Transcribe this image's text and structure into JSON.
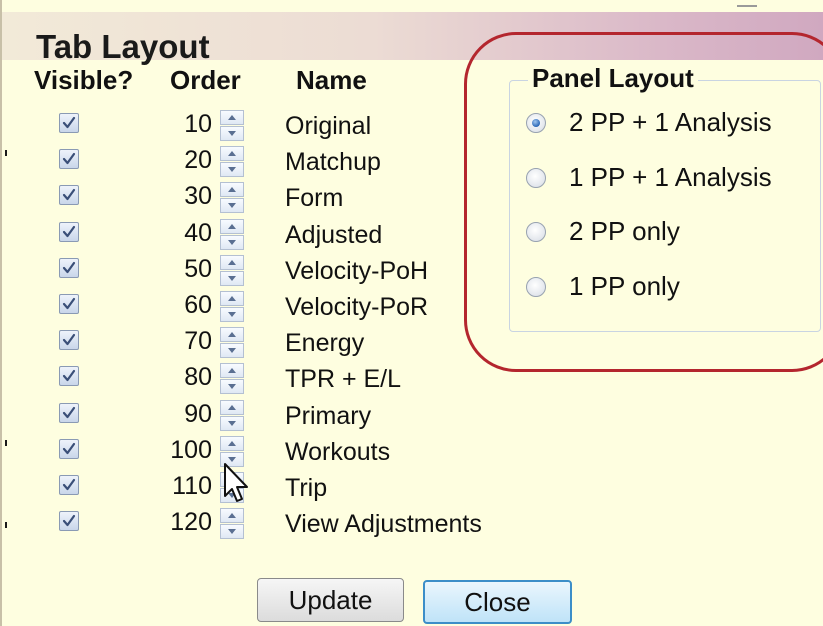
{
  "dialog": {
    "title": "Tab Layout",
    "columns": {
      "visible": "Visible?",
      "order": "Order",
      "name": "Name"
    },
    "tabs": [
      {
        "visible": true,
        "order": "10",
        "name": "Original"
      },
      {
        "visible": true,
        "order": "20",
        "name": "Matchup"
      },
      {
        "visible": true,
        "order": "30",
        "name": "Form"
      },
      {
        "visible": true,
        "order": "40",
        "name": "Adjusted"
      },
      {
        "visible": true,
        "order": "50",
        "name": "Velocity-PoH"
      },
      {
        "visible": true,
        "order": "60",
        "name": "Velocity-PoR"
      },
      {
        "visible": true,
        "order": "70",
        "name": "Energy"
      },
      {
        "visible": true,
        "order": "80",
        "name": "TPR + E/L"
      },
      {
        "visible": true,
        "order": "90",
        "name": "Primary"
      },
      {
        "visible": true,
        "order": "100",
        "name": "Workouts"
      },
      {
        "visible": true,
        "order": "110",
        "name": "Trip"
      },
      {
        "visible": true,
        "order": "120",
        "name": "View Adjustments"
      }
    ],
    "panel_layout": {
      "legend": "Panel Layout",
      "options": [
        {
          "label": "2 PP + 1 Analysis",
          "selected": true
        },
        {
          "label": "1 PP + 1 Analysis",
          "selected": false
        },
        {
          "label": "2 PP only",
          "selected": false
        },
        {
          "label": "1 PP only",
          "selected": false
        }
      ]
    },
    "buttons": {
      "update": "Update",
      "close": "Close"
    }
  },
  "icons": {
    "checkbox": "checkmark-icon",
    "spinner": "up-down-arrows-icon",
    "cursor": "mouse-pointer-icon"
  },
  "colors": {
    "dialog_background": "#fefee0",
    "highlight_ring": "#b4262e",
    "close_button_border": "#3c8ec8",
    "radio_selected": "#2a66b6"
  }
}
